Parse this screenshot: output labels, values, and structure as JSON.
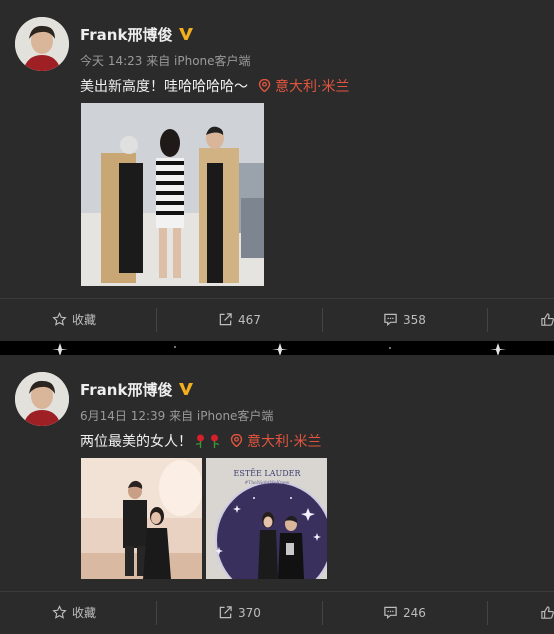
{
  "posts": [
    {
      "name": "Frank邢博俊",
      "meta": "今天 14:23 来自 iPhone客户端",
      "text": "美出新高度！哇哈哈哈哈～",
      "location": "意大利·米兰",
      "actions": {
        "favorite": "收藏",
        "repost": "467",
        "comment": "358"
      }
    },
    {
      "name": "Frank邢博俊",
      "meta": "6月14日 12:39 来自 iPhone客户端",
      "text": "两位最美的女人！",
      "location": "意大利·米兰",
      "actions": {
        "favorite": "收藏",
        "repost": "370",
        "comment": "246"
      },
      "photo_text": {
        "brand": "ESTĒE LAUDER",
        "tagline": "#TheNightWeKnew"
      }
    }
  ],
  "colors": {
    "background": "#2b2b2b",
    "location": "#e1553f",
    "verified": "#f2b01e"
  },
  "icons": [
    "verified-v-icon",
    "location-pin-icon",
    "star-icon",
    "share-icon",
    "comment-icon",
    "like-icon",
    "rose-emoji-icon"
  ]
}
